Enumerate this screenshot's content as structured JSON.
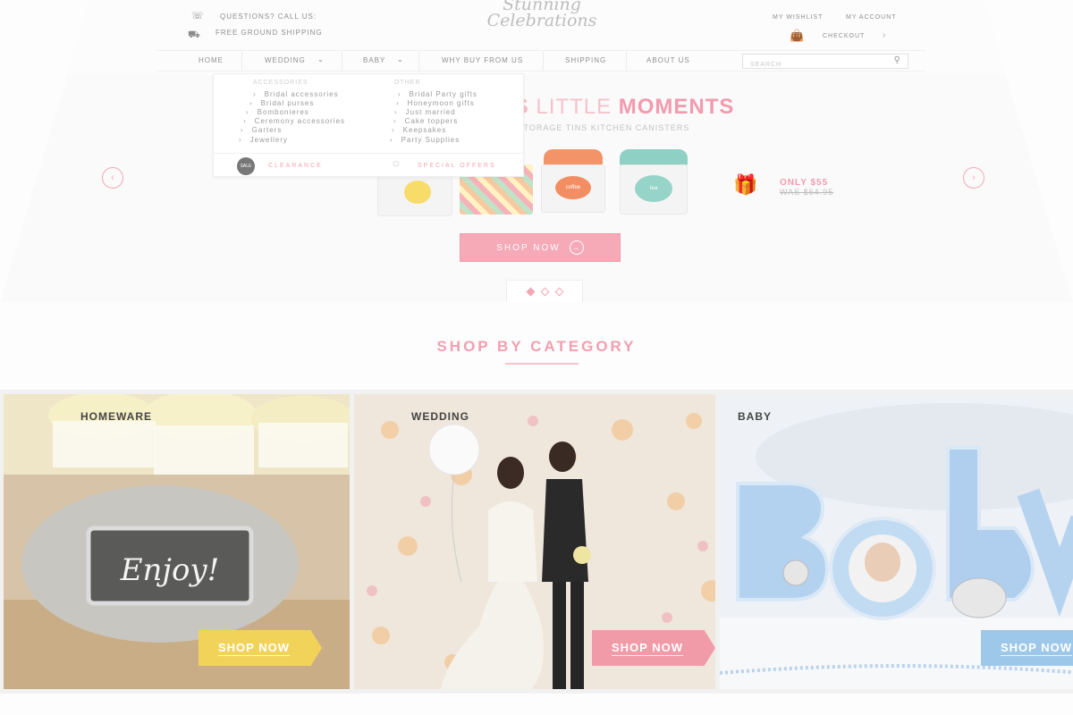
{
  "header": {
    "phone_label": "QUESTIONS? CALL US:",
    "phone_number": "",
    "shipping_label": "FREE GROUND SHIPPING",
    "shipping_sub": "",
    "logo_line1": "Stunning",
    "logo_line2": "Celebrations",
    "wishlist": "MY WISHLIST",
    "account": "MY ACCOUNT",
    "checkout": "CHECKOUT"
  },
  "nav": {
    "items": [
      "HOME",
      "WEDDING",
      "BABY",
      "WHY BUY FROM US",
      "SHIPPING",
      "ABOUT US"
    ],
    "search_placeholder": "SEARCH"
  },
  "dropdown": {
    "col1_heading": "ACCESSORIES",
    "col1": [
      "Bridal accessories",
      "Bridal purses",
      "Bombonieres",
      "Ceremony accessories",
      "Garters",
      "Jewellery"
    ],
    "col2_heading": "OTHER",
    "col2": [
      "Bridal Party gifts",
      "Honeymoon gifts",
      "Just married",
      "Cake toppers",
      "Keepsakes",
      "Party Supplies"
    ],
    "promo_clearance": "CLEARANCE",
    "promo_offers": "SPECIAL OFFERS"
  },
  "hero": {
    "title_part1": "'S",
    "title_part2": "LITTLE",
    "title_part3": "MOMENTS",
    "subtitle": "LE STORAGE TINS KITCHEN CANISTERS",
    "tin_labels": [
      "",
      "",
      "coffee",
      "tea"
    ],
    "price_only": "ONLY $55",
    "price_was": "WAS $64.95",
    "button": "SHOP NOW"
  },
  "category_section": {
    "heading": "SHOP BY CATEGORY",
    "cards": [
      {
        "label": "HOMEWARE",
        "button": "SHOP NOW",
        "sign_text": "Enjoy!"
      },
      {
        "label": "WEDDING",
        "button": "SHOP NOW"
      },
      {
        "label": "BABY",
        "button": "SHOP NOW"
      }
    ]
  },
  "colors": {
    "accent_pink": "#f39aae",
    "homeware_button": "#f2d35a",
    "wedding_button": "#f19aa8",
    "baby_button": "#9ec8ea"
  }
}
